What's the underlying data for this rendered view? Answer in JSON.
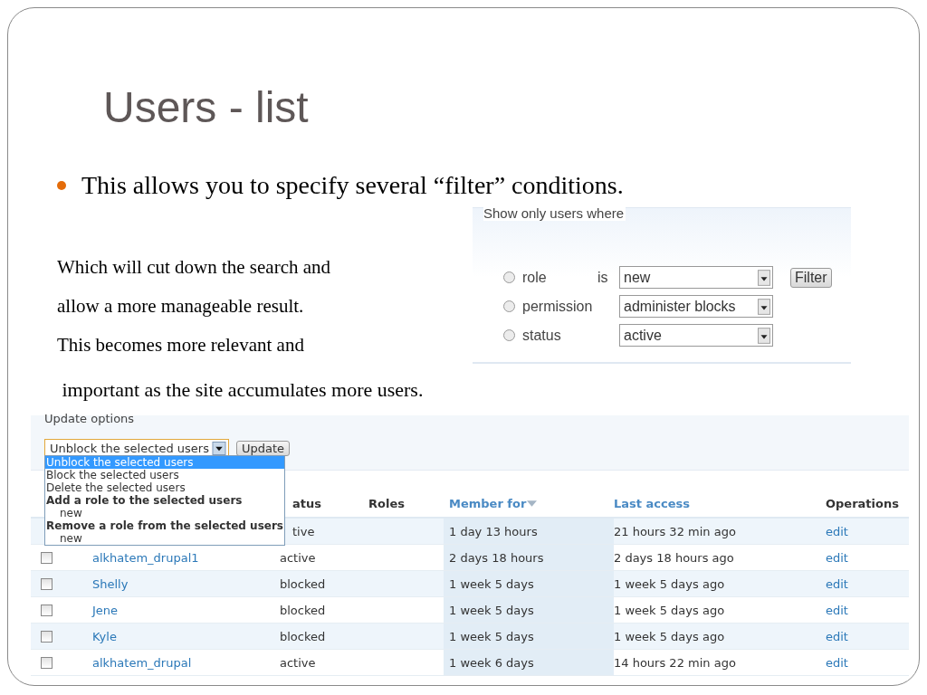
{
  "slide": {
    "title": "Users - list",
    "bullet": "This allows you to specify several “filter” conditions.",
    "paragraph_lines": [
      "Which will cut down the search and",
      "allow a more manageable result.",
      "This becomes more relevant and",
      " important as the site accumulates more users."
    ]
  },
  "filter_panel": {
    "legend": "Show only users where",
    "operator": "is",
    "button": "Filter",
    "rows": [
      {
        "label": "role",
        "selected": false,
        "value": "new"
      },
      {
        "label": "permission",
        "selected": false,
        "value": "administer blocks"
      },
      {
        "label": "status",
        "selected": false,
        "value": "active"
      }
    ]
  },
  "update_panel": {
    "legend": "Update options",
    "select_value": "Unblock the selected users",
    "button": "Update",
    "menu": [
      {
        "kind": "option",
        "label": "Unblock the selected users",
        "selected": true
      },
      {
        "kind": "option",
        "label": "Block the selected users",
        "selected": false
      },
      {
        "kind": "option",
        "label": "Delete the selected users",
        "selected": false
      },
      {
        "kind": "group",
        "label": "Add a role to the selected users",
        "children": [
          {
            "label": "new",
            "selected": false
          }
        ]
      },
      {
        "kind": "group",
        "label": "Remove a role from the selected users",
        "children": [
          {
            "label": "new",
            "selected": false
          }
        ]
      }
    ]
  },
  "users_table": {
    "columns": [
      {
        "label": "atus",
        "kind": "plain",
        "under_menu": true
      },
      {
        "label": "Roles",
        "kind": "plain"
      },
      {
        "label": "Member for",
        "kind": "sorted"
      },
      {
        "label": "Last access",
        "kind": "sortable"
      },
      {
        "label": "Operations",
        "kind": "plain"
      }
    ],
    "rows": [
      {
        "status": "tive",
        "under_menu": true,
        "member_for": "1 day 13 hours",
        "last_access": "21 hours 32 min ago",
        "operation": "edit"
      },
      {
        "checked": false,
        "name": "alkhatem_drupal1",
        "status": "active",
        "member_for": "2 days 18 hours",
        "last_access": "2 days 18 hours ago",
        "operation": "edit"
      },
      {
        "checked": false,
        "name": "Shelly",
        "status": "blocked",
        "member_for": "1 week 5 days",
        "last_access": "1 week 5 days ago",
        "operation": "edit"
      },
      {
        "checked": false,
        "name": "Jene",
        "status": "blocked",
        "member_for": "1 week 5 days",
        "last_access": "1 week 5 days ago",
        "operation": "edit"
      },
      {
        "checked": false,
        "name": "Kyle",
        "status": "blocked",
        "member_for": "1 week 5 days",
        "last_access": "1 week 5 days ago",
        "operation": "edit"
      },
      {
        "checked": false,
        "name": "alkhatem_drupal",
        "status": "active",
        "member_for": "1 week 6 days",
        "last_access": "14 hours 22 min ago",
        "operation": "edit"
      }
    ]
  }
}
